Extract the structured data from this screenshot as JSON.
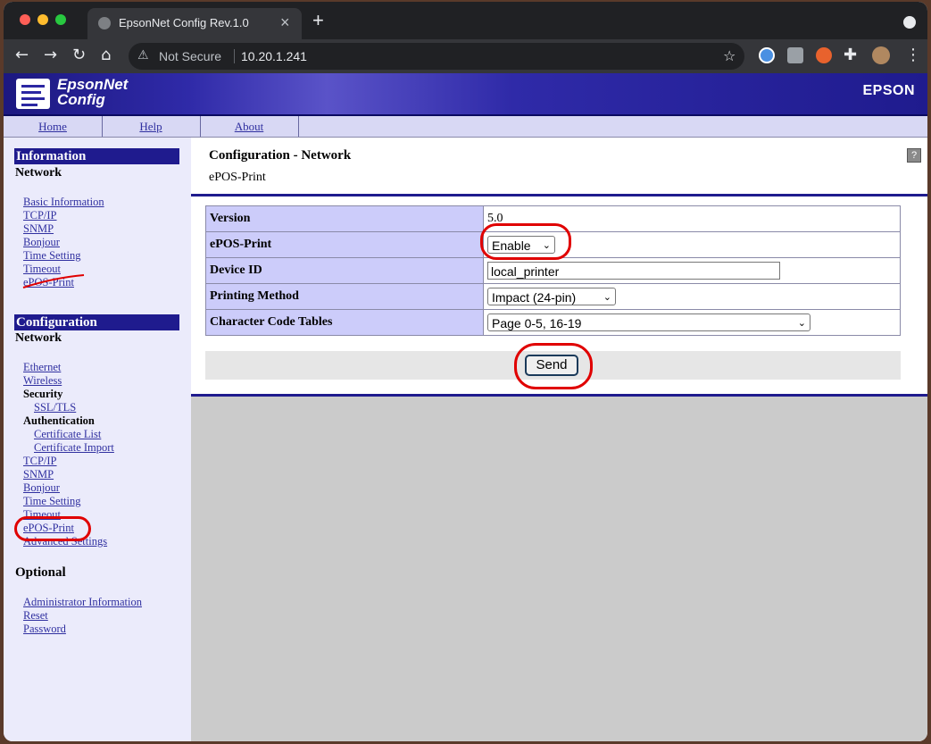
{
  "browser": {
    "tab_title": "EpsonNet Config Rev.1.0",
    "security_label": "Not Secure",
    "url": "10.20.1.241"
  },
  "banner": {
    "logo_line1": "EpsonNet",
    "logo_line2": "Config",
    "brand": "EPSON"
  },
  "nav": {
    "items": [
      "Home",
      "Help",
      "About"
    ]
  },
  "sidebar": {
    "information": {
      "heading": "Information",
      "subheading": "Network",
      "links": [
        "Basic Information",
        "TCP/IP",
        "SNMP",
        "Bonjour",
        "Time Setting",
        "Timeout",
        "ePOS-Print"
      ]
    },
    "configuration": {
      "heading": "Configuration",
      "subheading": "Network",
      "ethernet": "Ethernet",
      "wireless": "Wireless",
      "security": "Security",
      "ssl_tls": "SSL/TLS",
      "authentication": "Authentication",
      "cert_list": "Certificate List",
      "cert_import": "Certificate Import",
      "tcpip": "TCP/IP",
      "snmp": "SNMP",
      "bonjour": "Bonjour",
      "time_setting": "Time Setting",
      "timeout": "Timeout",
      "epos_print": "ePOS-Print",
      "advanced": "Advanced Settings"
    },
    "optional": {
      "heading": "Optional",
      "links": [
        "Administrator Information",
        "Reset",
        "Password"
      ]
    }
  },
  "main": {
    "title": "Configuration - Network",
    "subtitle": "ePOS-Print",
    "help_icon": "?",
    "rows": {
      "version_label": "Version",
      "version_value": "5.0",
      "epos_label": "ePOS-Print",
      "epos_value": "Enable",
      "device_id_label": "Device ID",
      "device_id_value": "local_printer",
      "printing_method_label": "Printing Method",
      "printing_method_value": "Impact (24-pin)",
      "char_tables_label": "Character Code Tables",
      "char_tables_value": "Page 0-5, 16-19"
    },
    "send_label": "Send"
  },
  "colors": {
    "annotation_ring": "#e00000",
    "banner_blue": "#1f1b8e",
    "label_cell": "#ccccfa",
    "link": "#3030a0"
  }
}
